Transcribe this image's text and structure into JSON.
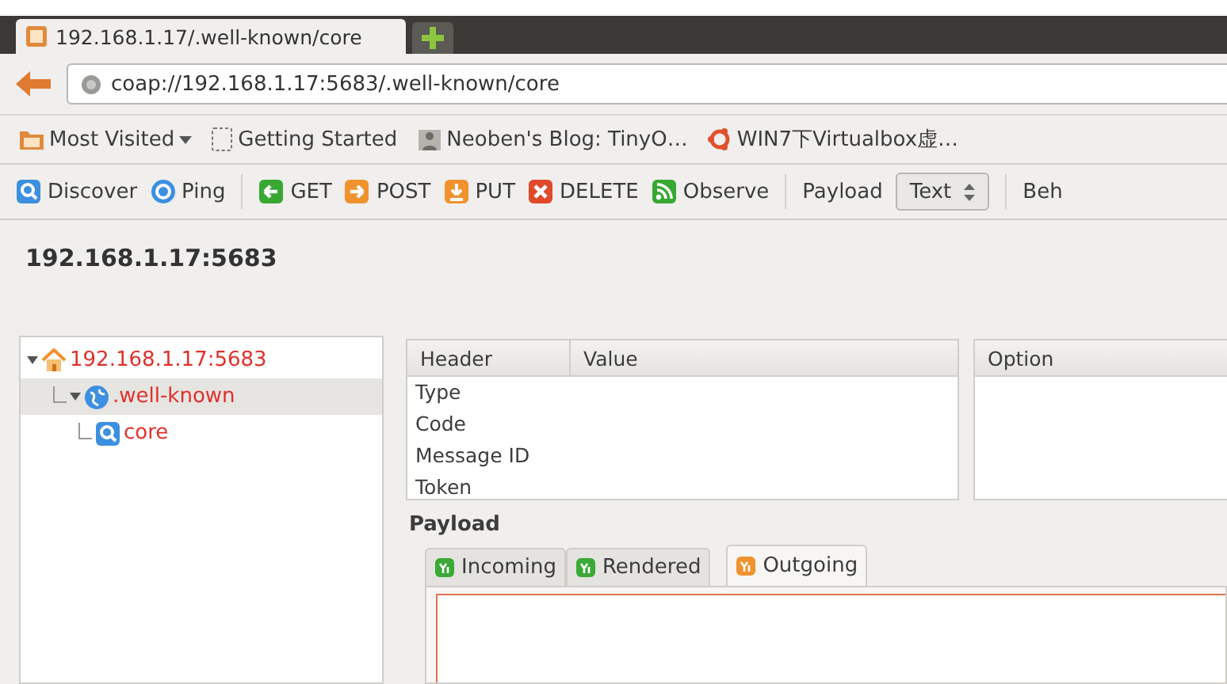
{
  "browser_tabs": [
    {
      "label": "192.168.1.17/.well-known/core",
      "selected": true
    }
  ],
  "address_bar": {
    "value": "coap://192.168.1.17:5683/.well-known/core"
  },
  "bookmarks": [
    {
      "label": "Most Visited",
      "kind": "menu"
    },
    {
      "label": "Getting Started",
      "kind": "page"
    },
    {
      "label": "Neoben's Blog: TinyO…",
      "kind": "blog"
    },
    {
      "label": "WIN7下Virtualbox虚…",
      "kind": "ubuntu"
    }
  ],
  "toolbar": [
    {
      "kind": "discover",
      "label": "Discover"
    },
    {
      "kind": "ping",
      "label": "Ping"
    },
    {
      "kind": "separator"
    },
    {
      "kind": "get",
      "label": "GET"
    },
    {
      "kind": "post",
      "label": "POST"
    },
    {
      "kind": "put",
      "label": "PUT"
    },
    {
      "kind": "delete",
      "label": "DELETE"
    },
    {
      "kind": "observe",
      "label": "Observe"
    },
    {
      "kind": "separator"
    },
    {
      "kind": "label",
      "label": "Payload"
    },
    {
      "kind": "select",
      "label": "Text"
    },
    {
      "kind": "separator"
    },
    {
      "kind": "plain",
      "label": "Beh"
    }
  ],
  "server_title": "192.168.1.17:5683",
  "tree": [
    {
      "label": "192.168.1.17:5683",
      "kind": "home",
      "expanded": true,
      "selected": false,
      "children": [
        {
          "label": ".well-known",
          "kind": "globe",
          "expanded": true,
          "selected": true,
          "children": [
            {
              "label": "core",
              "kind": "search",
              "selected": false
            }
          ]
        }
      ]
    }
  ],
  "headers_table": {
    "columns": [
      "Header",
      "Value"
    ],
    "rows": [
      "Type",
      "Code",
      "Message ID",
      "Token"
    ]
  },
  "options_table": {
    "columns": [
      "Option"
    ]
  },
  "payload": {
    "title": "Payload",
    "tabs": [
      {
        "label": "Incoming",
        "selected": false,
        "color": "#3aa935"
      },
      {
        "label": "Rendered",
        "selected": false,
        "color": "#3aa935"
      },
      {
        "label": "Outgoing",
        "selected": true,
        "color": "#f0922e"
      }
    ]
  }
}
